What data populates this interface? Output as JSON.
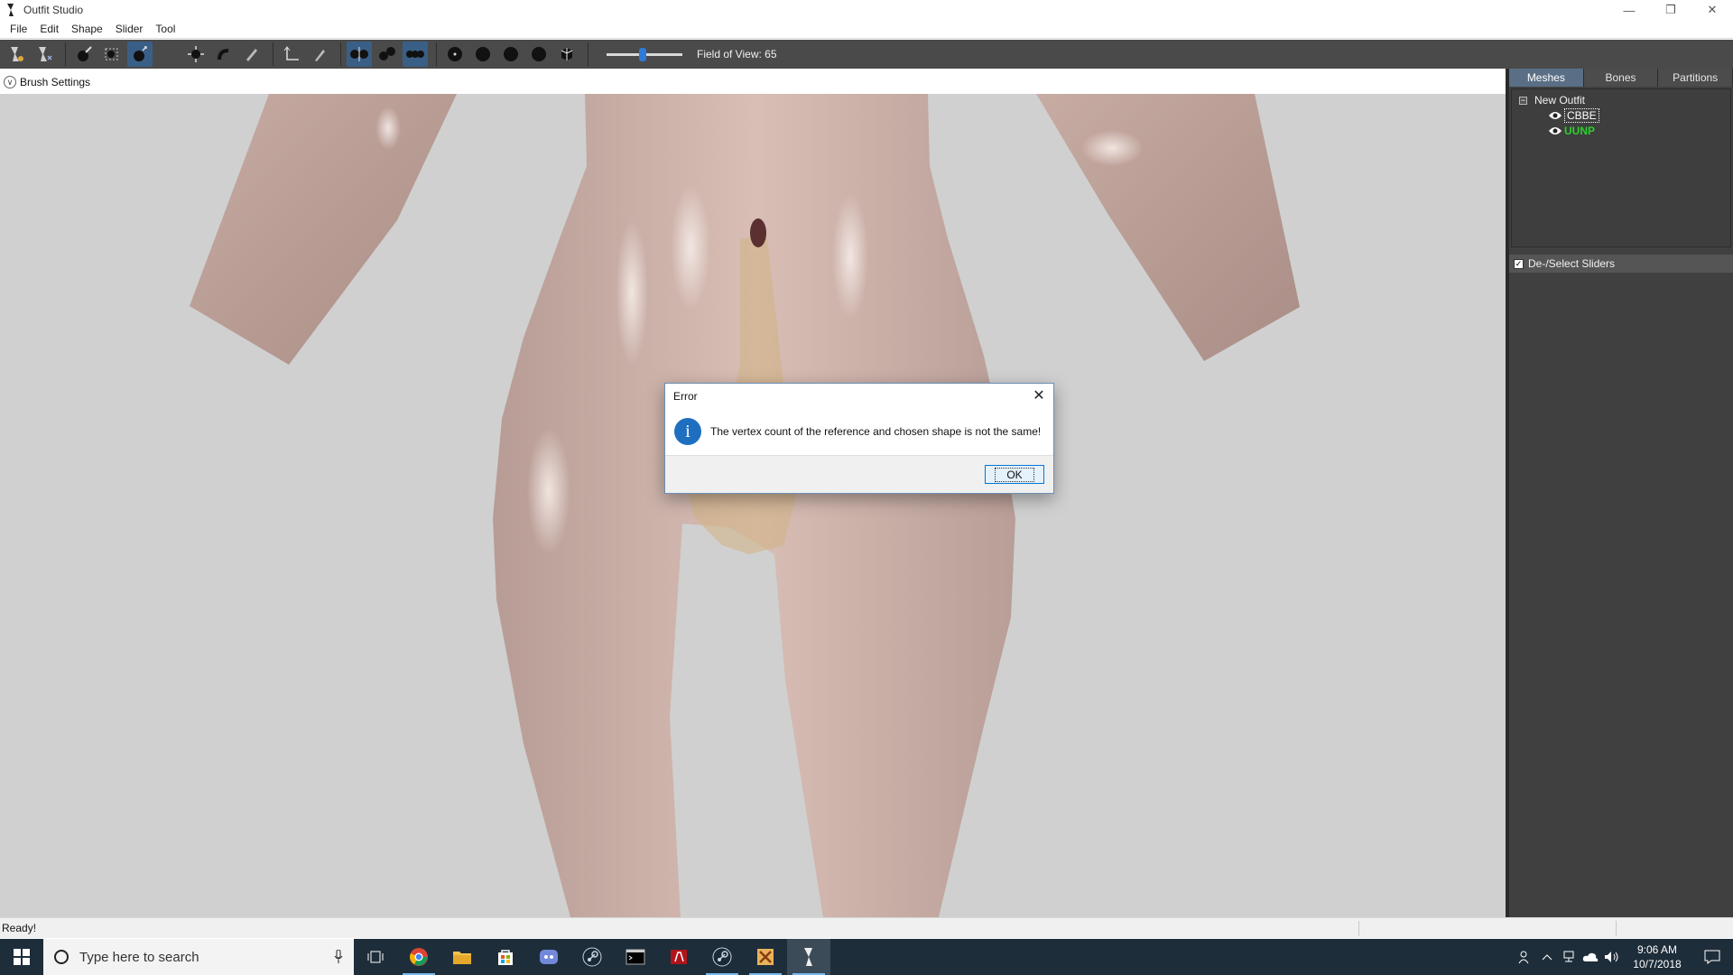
{
  "window": {
    "title": "Outfit Studio",
    "minimize": "—",
    "restore": "❐",
    "close": "✕"
  },
  "menu": [
    "File",
    "Edit",
    "Shape",
    "Slider",
    "Tool"
  ],
  "toolbar": {
    "fov_label": "Field of View: 65",
    "fov_value": 65
  },
  "brush_settings": {
    "label": "Brush Settings"
  },
  "right_panel": {
    "tabs": [
      "Meshes",
      "Bones",
      "Partitions"
    ],
    "active_tab": "Meshes",
    "tree": {
      "root": "New Outfit",
      "expander": "−",
      "shapes": [
        {
          "name": "CBBE",
          "color": "#ffffff"
        },
        {
          "name": "UUNP",
          "color": "#2ccf2c"
        }
      ]
    },
    "slider_header": {
      "label": "De-/Select Sliders",
      "checked": true,
      "check_glyph": "✓"
    }
  },
  "status": {
    "text": "Ready!"
  },
  "dialog": {
    "title": "Error",
    "close": "✕",
    "icon": "i",
    "message": "The vertex count of the reference and chosen shape is not the same!",
    "ok": "OK"
  },
  "taskbar": {
    "search_placeholder": "Type here to search",
    "apps": [
      "task-view",
      "chrome",
      "file-explorer",
      "store",
      "discord",
      "steam",
      "terminal",
      "red-app",
      "steam-2",
      "xedit",
      "outfit-studio"
    ],
    "clock_time": "9:06 AM",
    "clock_date": "10/7/2018"
  },
  "colors": {
    "toolbar_bg": "#4a4a4a",
    "panel_bg": "#404040",
    "accent": "#0078d7",
    "viewport_bg": "#d0d0d0"
  }
}
